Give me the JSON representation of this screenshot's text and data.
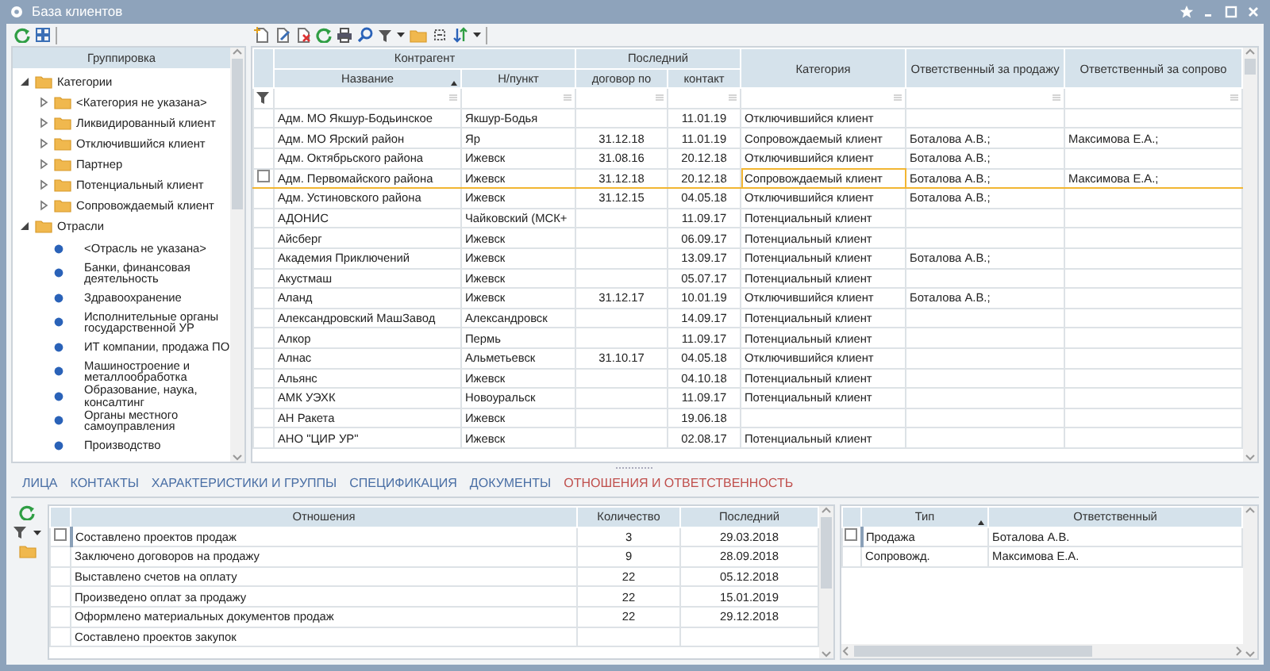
{
  "window": {
    "title": "База клиентов"
  },
  "grouping": {
    "title": "Группировка",
    "tree": [
      {
        "label": "Категории",
        "kind": "folder",
        "expanded": true,
        "children": [
          {
            "label": "<Категория не указана>",
            "kind": "folder",
            "expanded": false
          },
          {
            "label": "Ликвидированный клиент",
            "kind": "folder",
            "expanded": false
          },
          {
            "label": "Отключившийся клиент",
            "kind": "folder",
            "expanded": false
          },
          {
            "label": "Партнер",
            "kind": "folder",
            "expanded": false
          },
          {
            "label": "Потенциальный клиент",
            "kind": "folder",
            "expanded": false
          },
          {
            "label": "Сопровождаемый клиент",
            "kind": "folder",
            "expanded": false
          }
        ]
      },
      {
        "label": "Отрасли",
        "kind": "folder",
        "expanded": true,
        "children": [
          {
            "label": "<Отрасль не указана>",
            "kind": "item"
          },
          {
            "label": "Банки, финансовая деятельность",
            "kind": "item"
          },
          {
            "label": "Здравоохранение",
            "kind": "item"
          },
          {
            "label": "Исполнительные органы государственной УР",
            "kind": "item"
          },
          {
            "label": "ИТ компании, продажа ПО",
            "kind": "item"
          },
          {
            "label": "Машиностроение и металлообработка",
            "kind": "item"
          },
          {
            "label": "Образование, наука, консалтинг",
            "kind": "item"
          },
          {
            "label": "Органы местного самоуправления",
            "kind": "item"
          },
          {
            "label": "Производство",
            "kind": "item"
          }
        ]
      }
    ]
  },
  "clients": {
    "column_groups": [
      {
        "label": "Контрагент",
        "columns": [
          {
            "label": "Название",
            "sorted": true
          },
          {
            "label": "Н/пункт",
            "sorted": false
          }
        ]
      },
      {
        "label": "Последний",
        "columns": [
          {
            "label": "договор по",
            "sorted": false
          },
          {
            "label": "контакт",
            "sorted": false
          }
        ]
      },
      {
        "columns": [
          {
            "label": "Категория",
            "sorted": false
          }
        ]
      },
      {
        "columns": [
          {
            "label": "Ответственный за продажу",
            "sorted": false
          }
        ]
      },
      {
        "columns": [
          {
            "label": "Ответственный за сопрово",
            "sorted": false
          }
        ]
      }
    ],
    "rows": [
      {
        "name": "Адм. МО Якшур-Бодьинское",
        "town": "Якшур-Бодья",
        "contact": "11.01.19",
        "category": "Отключившийся клиент",
        "selected": false
      },
      {
        "name": "Адм. МО Ярский район",
        "town": "Яр",
        "contract": "31.12.18",
        "contact": "11.01.19",
        "category": "Сопровождаемый клиент",
        "sales": "Боталова А.В.;",
        "support": "Максимова Е.А.;",
        "selected": false
      },
      {
        "name": "Адм. Октябрьского района",
        "town": "Ижевск",
        "contract": "31.08.16",
        "contact": "20.12.18",
        "category": "Отключившийся клиент",
        "sales": "Боталова А.В.;",
        "selected": false
      },
      {
        "name": "Адм. Первомайского района",
        "town": "Ижевск",
        "contract": "31.12.18",
        "contact": "20.12.18",
        "category": "Сопровождаемый клиент",
        "sales": "Боталова А.В.;",
        "support": "Максимова Е.А.;",
        "selected": true
      },
      {
        "name": "Адм. Устиновского района",
        "town": "Ижевск",
        "contract": "31.12.15",
        "contact": "04.05.18",
        "category": "Отключившийся клиент",
        "sales": "Боталова А.В.;",
        "selected": false
      },
      {
        "name": "АДОНИС",
        "town": "Чайковский (МСК+",
        "contact": "11.09.17",
        "category": "Потенциальный клиент",
        "selected": false
      },
      {
        "name": "Айсберг",
        "town": "Ижевск",
        "contact": "06.09.17",
        "category": "Потенциальный клиент",
        "selected": false
      },
      {
        "name": "Академия Приключений",
        "town": "Ижевск",
        "contact": "13.09.17",
        "category": "Потенциальный клиент",
        "sales": "Боталова А.В.;",
        "selected": false
      },
      {
        "name": "Акустмаш",
        "town": "Ижевск",
        "contact": "05.07.17",
        "category": "Потенциальный клиент",
        "selected": false
      },
      {
        "name": "Аланд",
        "town": "Ижевск",
        "contract": "31.12.17",
        "contact": "10.01.19",
        "category": "Отключившийся клиент",
        "sales": "Боталова А.В.;",
        "selected": false
      },
      {
        "name": "Александровский МашЗавод",
        "town": "Александровск",
        "contact": "14.09.17",
        "category": "Потенциальный клиент",
        "selected": false
      },
      {
        "name": "Алкор",
        "town": "Пермь",
        "contact": "11.09.17",
        "category": "Потенциальный клиент",
        "selected": false
      },
      {
        "name": "Алнас",
        "town": "Альметьевск",
        "contract": "31.10.17",
        "contact": "04.05.18",
        "category": "Отключившийся клиент",
        "selected": false
      },
      {
        "name": "Альянс",
        "town": "Ижевск",
        "contact": "04.10.18",
        "category": "Потенциальный клиент",
        "selected": false
      },
      {
        "name": "АМК УЭХК",
        "town": "Новоуральск",
        "contact": "11.09.17",
        "category": "Потенциальный клиент",
        "selected": false
      },
      {
        "name": "АН Ракета",
        "town": "Ижевск",
        "contact": "19.06.18",
        "selected": false
      },
      {
        "name": "АНО \"ЦИР УР\"",
        "town": "Ижевск",
        "contact": "02.08.17",
        "category": "Потенциальный клиент",
        "selected": false
      }
    ]
  },
  "tabs": [
    {
      "label": "ЛИЦА",
      "selected": false
    },
    {
      "label": "КОНТАКТЫ",
      "selected": false
    },
    {
      "label": "ХАРАКТЕРИСТИКИ И ГРУППЫ",
      "selected": false
    },
    {
      "label": "СПЕЦИФИКАЦИЯ",
      "selected": false
    },
    {
      "label": "ДОКУМЕНТЫ",
      "selected": false
    },
    {
      "label": "ОТНОШЕНИЯ И ОТВЕТСТВЕННОСТЬ",
      "selected": true
    }
  ],
  "relations": {
    "columns": [
      "Отношения",
      "Количество",
      "Последний"
    ],
    "rows": [
      {
        "relation": "Составлено проектов продаж",
        "count": "3",
        "last": "29.03.2018",
        "selected": true
      },
      {
        "relation": "Заключено договоров на продажу",
        "count": "9",
        "last": "28.09.2018",
        "selected": false
      },
      {
        "relation": "Выставлено счетов на оплату",
        "count": "22",
        "last": "05.12.2018",
        "selected": false
      },
      {
        "relation": "Произведено оплат за продажу",
        "count": "22",
        "last": "15.01.2019",
        "selected": false
      },
      {
        "relation": "Оформлено материальных документов продаж",
        "count": "22",
        "last": "29.12.2018",
        "selected": false
      },
      {
        "relation": "Составлено проектов закупок",
        "selected": false
      }
    ]
  },
  "responsible": {
    "columns": [
      {
        "label": "Тип",
        "sorted": true
      },
      {
        "label": "Ответственный",
        "sorted": false
      }
    ],
    "rows": [
      {
        "type": "Продажа",
        "person": "Боталова А.В.",
        "selected": true
      },
      {
        "type": "Сопровожд.",
        "person": "Максимова Е.А.",
        "selected": false
      }
    ]
  }
}
